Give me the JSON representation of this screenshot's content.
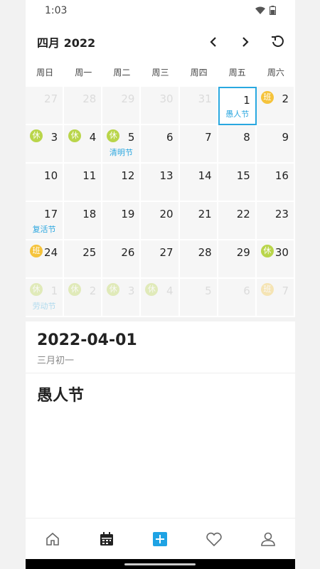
{
  "status": {
    "time": "1:03"
  },
  "header": {
    "title": "四月 2022"
  },
  "weekdays": [
    "周日",
    "周一",
    "周二",
    "周三",
    "周四",
    "周五",
    "周六"
  ],
  "calendar": [
    {
      "day": "27",
      "dim": true
    },
    {
      "day": "28",
      "dim": true
    },
    {
      "day": "29",
      "dim": true
    },
    {
      "day": "30",
      "dim": true
    },
    {
      "day": "31",
      "dim": true
    },
    {
      "day": "1",
      "selected": true,
      "festival": "愚人节"
    },
    {
      "day": "2",
      "badge": "班",
      "badgeType": "work"
    },
    {
      "day": "3",
      "badge": "休",
      "badgeType": "rest"
    },
    {
      "day": "4",
      "badge": "休",
      "badgeType": "rest"
    },
    {
      "day": "5",
      "badge": "休",
      "badgeType": "rest",
      "festival": "清明节"
    },
    {
      "day": "6"
    },
    {
      "day": "7"
    },
    {
      "day": "8"
    },
    {
      "day": "9"
    },
    {
      "day": "10"
    },
    {
      "day": "11"
    },
    {
      "day": "12"
    },
    {
      "day": "13"
    },
    {
      "day": "14"
    },
    {
      "day": "15"
    },
    {
      "day": "16"
    },
    {
      "day": "17",
      "festival": "复活节"
    },
    {
      "day": "18"
    },
    {
      "day": "19"
    },
    {
      "day": "20"
    },
    {
      "day": "21"
    },
    {
      "day": "22"
    },
    {
      "day": "23"
    },
    {
      "day": "24",
      "badge": "班",
      "badgeType": "work"
    },
    {
      "day": "25"
    },
    {
      "day": "26"
    },
    {
      "day": "27"
    },
    {
      "day": "28"
    },
    {
      "day": "29"
    },
    {
      "day": "30",
      "badge": "休",
      "badgeType": "rest"
    },
    {
      "day": "1",
      "dim": true,
      "badge": "休",
      "badgeType": "rest",
      "festival": "劳动节"
    },
    {
      "day": "2",
      "dim": true,
      "badge": "休",
      "badgeType": "rest"
    },
    {
      "day": "3",
      "dim": true,
      "badge": "休",
      "badgeType": "rest"
    },
    {
      "day": "4",
      "dim": true,
      "badge": "休",
      "badgeType": "rest"
    },
    {
      "day": "5",
      "dim": true
    },
    {
      "day": "6",
      "dim": true
    },
    {
      "day": "7",
      "dim": true,
      "badge": "班",
      "badgeType": "work"
    }
  ],
  "detail": {
    "date": "2022-04-01",
    "lunar": "三月初一",
    "festival": "愚人节"
  },
  "colors": {
    "accent": "#29a8e0",
    "rest": "#b9d54a",
    "work": "#f5c33b"
  },
  "nav": [
    {
      "icon": "home-icon"
    },
    {
      "icon": "calendar-icon",
      "active": true
    },
    {
      "icon": "add-icon"
    },
    {
      "icon": "heart-icon"
    },
    {
      "icon": "user-icon"
    }
  ]
}
